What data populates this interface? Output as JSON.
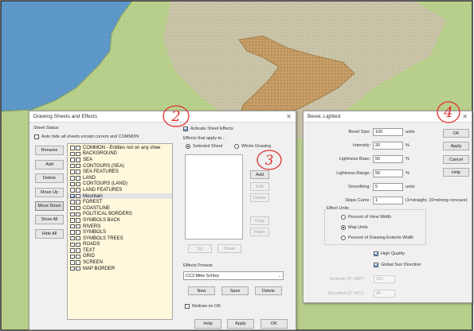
{
  "drawing_sheets": {
    "title": "Drawing Sheets and Effects",
    "sheet_status_label": "Sheet Status",
    "auto_hide_label": "Auto hide all sheets except current and COMMON",
    "buttons": [
      "Rename",
      "Add",
      "Delete",
      "Move Up",
      "Move Down",
      "Show All",
      "Hide All"
    ],
    "sheets": [
      {
        "name": "COMMON - Entities not on any shee",
        "checked": false
      },
      {
        "name": "BACKGROUND",
        "checked": false
      },
      {
        "name": "SEA",
        "checked": false
      },
      {
        "name": "CONTOURS (SEA)",
        "checked": false
      },
      {
        "name": "SEA FEATURES",
        "checked": false
      },
      {
        "name": "LAND",
        "checked": false
      },
      {
        "name": "CONTOURS (LAND)",
        "checked": false
      },
      {
        "name": "LAND FEATURES",
        "checked": false
      },
      {
        "name": "Mountain",
        "checked": true
      },
      {
        "name": "FOREST",
        "checked": false
      },
      {
        "name": "COASTLINE",
        "checked": false
      },
      {
        "name": "POLITICAL BORDERS",
        "checked": false
      },
      {
        "name": "SYMBOLS BACK",
        "checked": false
      },
      {
        "name": "RIVERS",
        "checked": false
      },
      {
        "name": "SYMBOLS",
        "checked": false
      },
      {
        "name": "SYMBOLS TREES",
        "checked": false
      },
      {
        "name": "ROADS",
        "checked": false
      },
      {
        "name": "TEXT",
        "checked": false
      },
      {
        "name": "GRID",
        "checked": false
      },
      {
        "name": "SCREEN",
        "checked": false
      },
      {
        "name": "MAP BORDER",
        "checked": false
      }
    ],
    "activate_label": "Activate Sheet Effects",
    "effects_apply_label": "Effects that apply to...",
    "selected_sheet_label": "Selected Sheet",
    "whole_drawing_label": "Whole Drawing",
    "effect_buttons": {
      "add": "Add",
      "edit": "Edit",
      "delete": "Delete",
      "copy": "Copy",
      "paste": "Paste",
      "up": "Up",
      "down": "Down"
    },
    "presets_label": "Effects Presets",
    "preset_value": "CC3 Mike Schley",
    "preset_buttons": {
      "new": "New",
      "save": "Save",
      "delete": "Delete"
    },
    "redraw_label": "Redraw on OK",
    "bottom_buttons": {
      "help": "Help",
      "apply": "Apply",
      "ok": "OK"
    }
  },
  "bevel": {
    "title": "Bevel, Lighted",
    "fields": [
      {
        "label": "Bevel Size:",
        "value": "100",
        "unit": "units"
      },
      {
        "label": "Intensity:",
        "value": "20",
        "unit": "%"
      },
      {
        "label": "Lightness Base:",
        "value": "50",
        "unit": "%"
      },
      {
        "label": "Lightness Range:",
        "value": "50",
        "unit": "%"
      },
      {
        "label": "Smoothing:",
        "value": "5",
        "unit": "units"
      },
      {
        "label": "Slope Curve:",
        "value": "1",
        "unit": "(1=straight, 10=strong concave)"
      }
    ],
    "buttons": {
      "ok": "OK",
      "apply": "Apply",
      "cancel": "Cancel",
      "help": "Help"
    },
    "effect_units_label": "Effect Units",
    "units_options": [
      "Percent of View Width",
      "Map Units",
      "Percent of Drawing Extents Width"
    ],
    "units_selected": 1,
    "high_quality_label": "High Quality",
    "global_sun_label": "Global Sun Direction",
    "azimuth_label": "Azimuth (0°-360°):",
    "azimuth_value": "315",
    "elevation_label": "Elevation (0°-90°):",
    "elevation_value": "45"
  },
  "annotations": [
    "2",
    "3",
    "4"
  ],
  "colors": {
    "sea": "#5c97c8",
    "grass": "#b8cf8c",
    "sand": "#c9c3a8",
    "mountain": "#c49b64",
    "annotation_red": "#e03030",
    "list_bg": "#fff8dc"
  }
}
